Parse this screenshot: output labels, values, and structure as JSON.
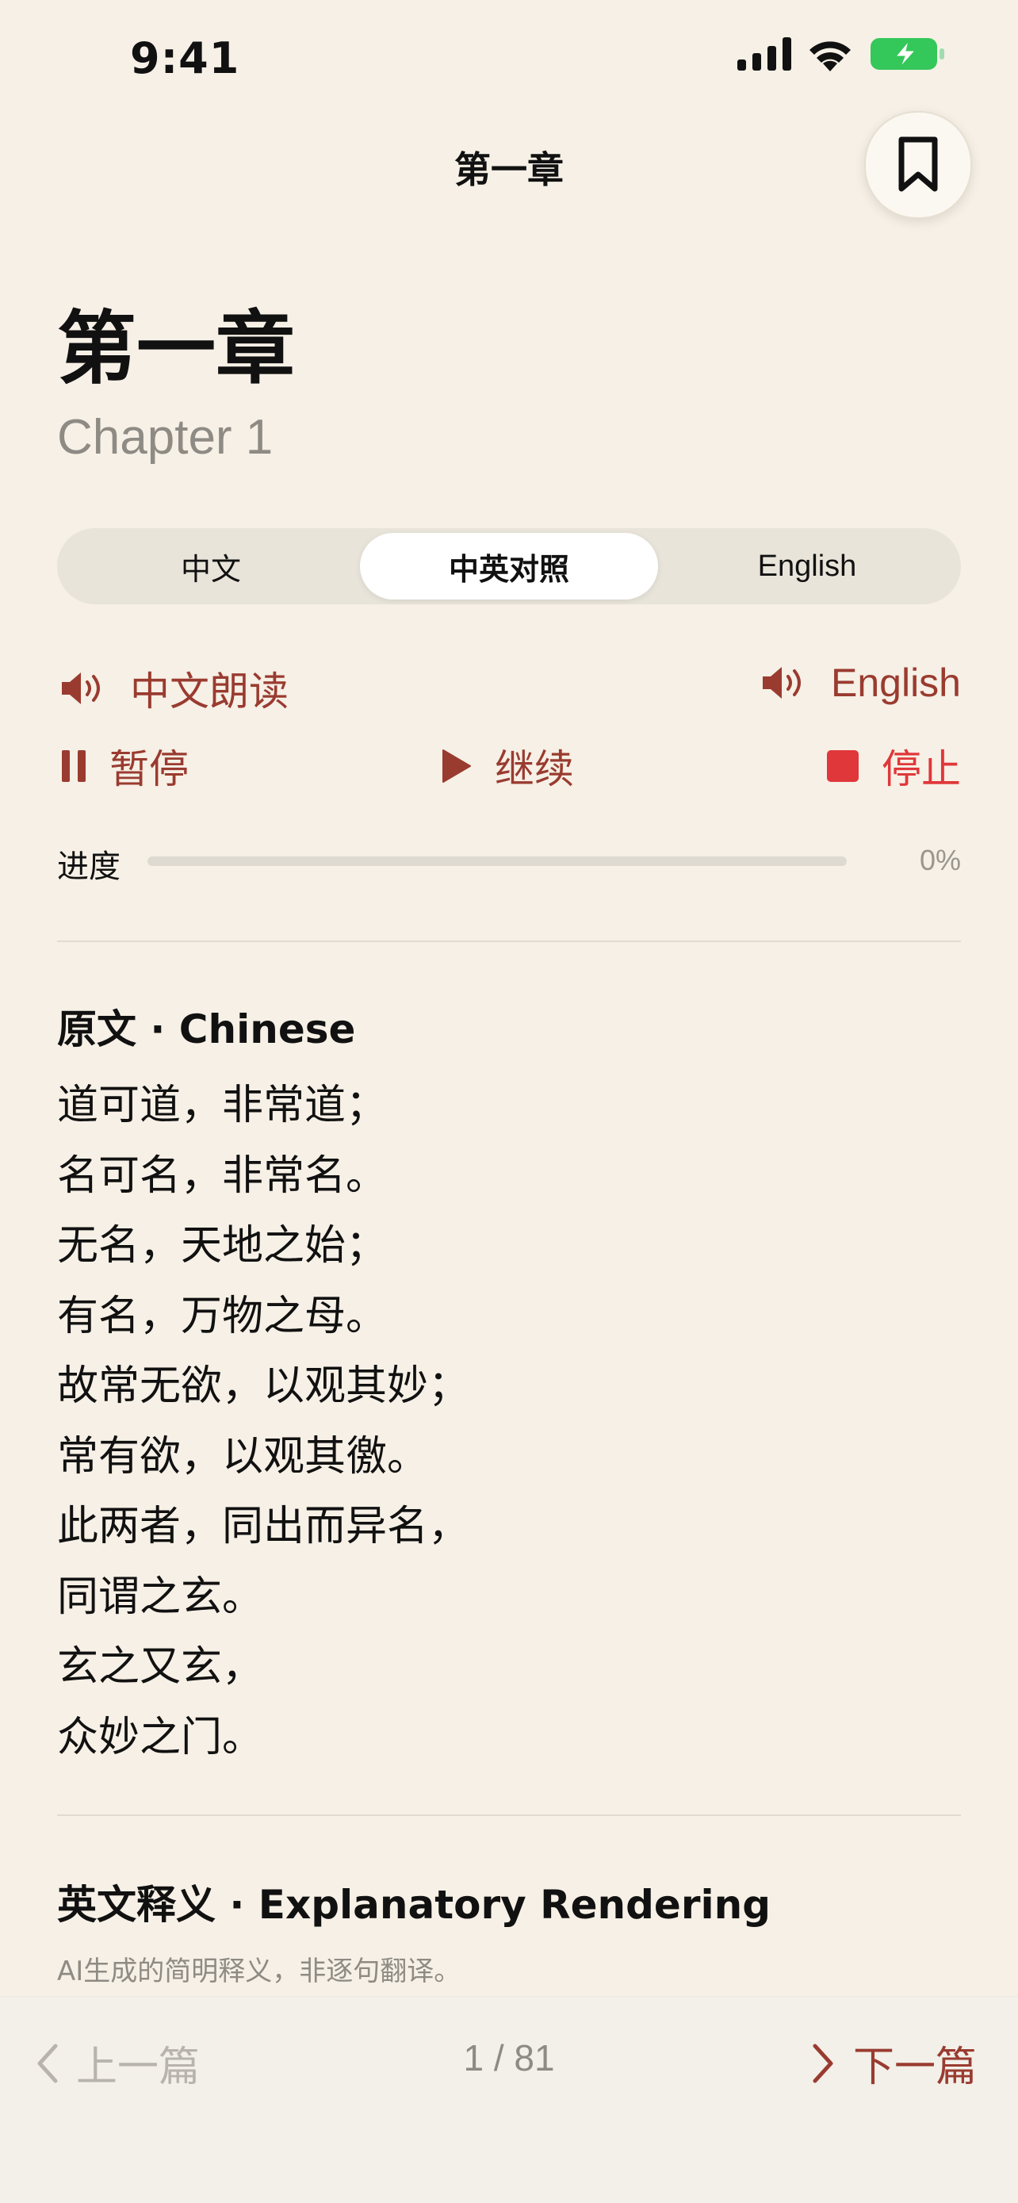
{
  "status_bar": {
    "time": "9:41"
  },
  "nav": {
    "title": "第一章",
    "bookmark_icon": "bookmark-icon"
  },
  "chapter": {
    "title": "第一章",
    "subtitle": "Chapter 1"
  },
  "modes": {
    "items": [
      "中文",
      "中英对照",
      "English"
    ],
    "selected": "中英对照"
  },
  "audio": {
    "read_chinese": "中文朗读",
    "read_english": "English",
    "pause": "暂停",
    "resume": "继续",
    "stop": "停止"
  },
  "progress": {
    "label": "进度",
    "percent_text": "0%",
    "value": 0
  },
  "original": {
    "heading": "原文 · Chinese",
    "lines": [
      "道可道，非常道；",
      "名可名，非常名。",
      "无名，天地之始；",
      "有名，万物之母。",
      "故常无欲，以观其妙；",
      "常有欲，以观其徼。",
      "此两者，同出而异名，",
      "同谓之玄。",
      "玄之又玄，",
      "众妙之门。"
    ]
  },
  "explanation": {
    "heading": "英文释义 · Explanatory Rendering",
    "note": "AI生成的简明释义，非逐句翻译。"
  },
  "footer": {
    "prev": "上一篇",
    "page": "1 / 81",
    "next": "下一篇"
  },
  "colors": {
    "background": "#f6f0e6",
    "accent": "#9a3b30",
    "stop": "#e0373a",
    "battery": "#34c759"
  }
}
